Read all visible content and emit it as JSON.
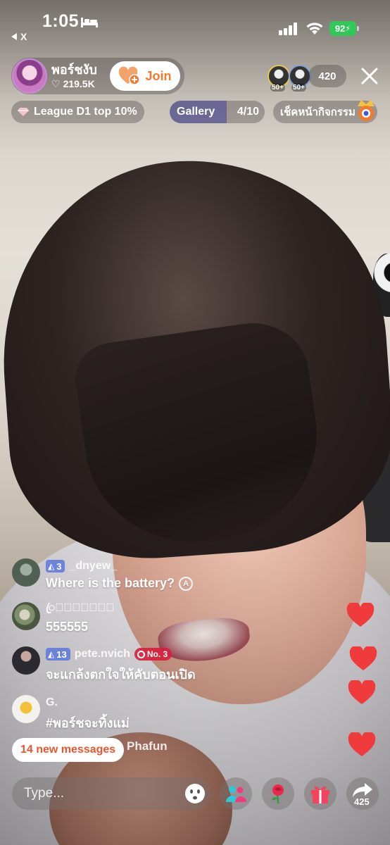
{
  "status_bar": {
    "time": "1:05",
    "back_label": "X",
    "battery": "92"
  },
  "host": {
    "name": "พอร์ชงับ",
    "likes": "219.5K",
    "join_label": "Join"
  },
  "viewers": {
    "badge_1": "50+",
    "badge_2": "50+",
    "count": "420"
  },
  "chips": {
    "league": "League D1 top 10%",
    "gallery_label": "Gallery",
    "gallery_count": "4/10",
    "gallery_progress": 0.4,
    "event_label": "เช็คหน้ากิจกรรม"
  },
  "comments": [
    {
      "level": "3",
      "user": "_dnyew_",
      "text": "Where is the battery?"
    },
    {
      "user": "ꦿ𝐋𝐀𝐋𝐈𝐃𝐀ꦿ",
      "text": "555555"
    },
    {
      "level": "13",
      "user": "pete.nvich",
      "rank": "No. 3",
      "text": "จะแกล้งตกใจให้คับตอนเปิด"
    },
    {
      "user": "G.",
      "text": "#พอร์ชจะทิ้งแม่"
    }
  ],
  "partial_user": "Phafun",
  "new_messages": "14 new messages",
  "input": {
    "placeholder": "Type..."
  },
  "share_count": "425",
  "colors": {
    "accent_orange": "#f07a2d",
    "heart_red": "#ef3b3b",
    "battery_green": "#33c759",
    "new_msg_text": "#f0542c"
  },
  "icons": [
    "bed-icon",
    "signal-icon",
    "wifi-icon",
    "heart-icon",
    "close-icon",
    "gem-icon",
    "emoji-icon",
    "group-icon",
    "rose-icon",
    "gift-icon",
    "share-icon"
  ]
}
